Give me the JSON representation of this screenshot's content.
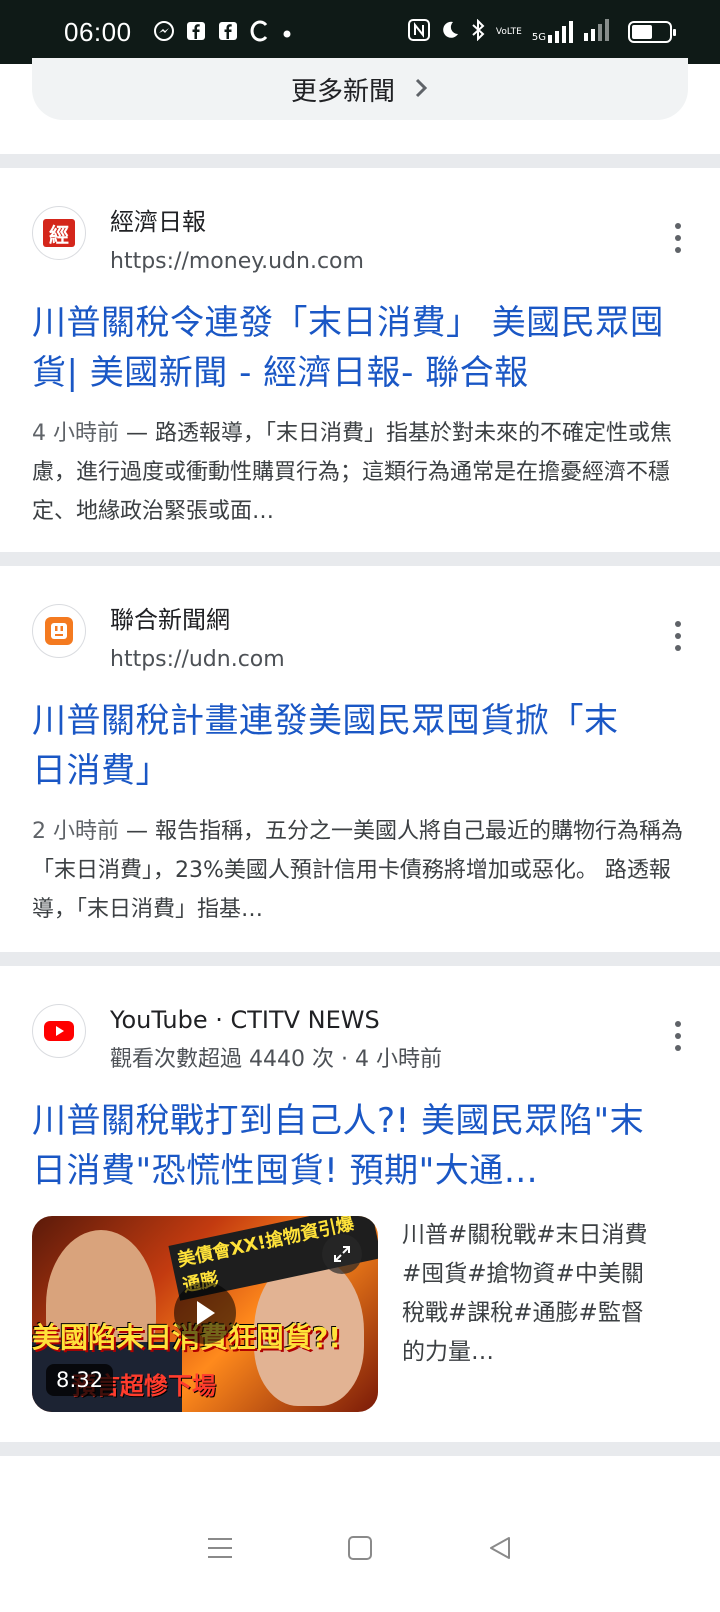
{
  "status_bar": {
    "time": "06:00",
    "network_label": "VoLTE",
    "signal_label": "5G"
  },
  "more_news": {
    "label": "更多新聞"
  },
  "results": [
    {
      "source_name": "經濟日報",
      "source_url": "https://money.udn.com",
      "favicon": "udn-money-favicon",
      "title": "川普關稅令連發「末日消費」 美國民眾囤貨| 美國新聞 - 經濟日報- 聯合報",
      "date": "4 小時前",
      "snippet": " — 路透報導，「末日消費」指基於對未來的不確定性或焦慮，進行過度或衝動性購買行為；這類行為通常是在擔憂經濟不穩定、地緣政治緊張或面…"
    },
    {
      "source_name": "聯合新聞網",
      "source_url": "https://udn.com",
      "favicon": "udn-favicon",
      "title": "川普關稅計畫連發美國民眾囤貨掀「末日消費」",
      "date": "2 小時前",
      "snippet": " — 報告指稱，五分之一美國人將自己最近的購物行為稱為「末日消費」，23%美國人預計信用卡債務將增加或惡化。 路透報導，「末日消費」指基…"
    },
    {
      "source_name": "YouTube · CTITV NEWS",
      "source_meta": "觀看次數超過 4440 次 · 4 小時前",
      "favicon": "youtube-favicon",
      "title": "川普關稅戰打到自己人?! 美國民眾陷\"末日消費\"恐慌性囤貨! 預期\"大通…",
      "video": {
        "duration": "8:32",
        "thumb_top_text": "美債會XX!搶物資引爆通膨",
        "thumb_mid_text": "美國陷末日消費狂囤貨?!",
        "thumb_bottom_text": "預言超慘下場",
        "description": "川普#關稅戰#末日消費#囤貨#搶物資#中美關稅戰#課稅#通膨#監督的力量…"
      }
    }
  ],
  "colors": {
    "link": "#1a57c5",
    "divider": "#e8eaed",
    "status_bar": "#0f1a17"
  }
}
